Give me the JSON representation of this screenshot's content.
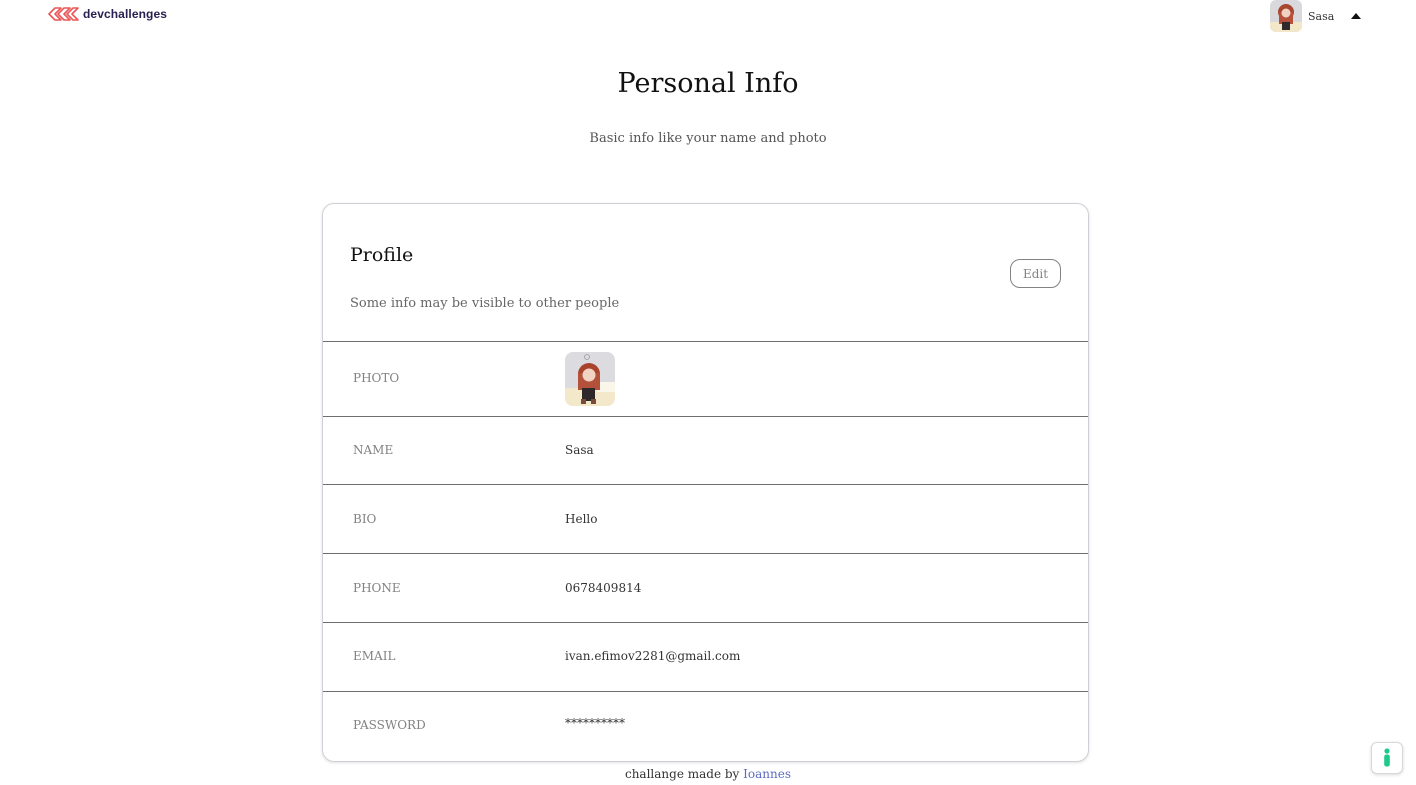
{
  "header": {
    "logo_text": "devchallenges",
    "user_name": "Sasa"
  },
  "page": {
    "title": "Personal Info",
    "subtitle": "Basic info like your name and photo"
  },
  "profile": {
    "title": "Profile",
    "subtitle": "Some info may be visible to other people",
    "edit_label": "Edit",
    "rows": {
      "photo": {
        "label": "PHOTO"
      },
      "name": {
        "label": "NAME",
        "value": "Sasa"
      },
      "bio": {
        "label": "BIO",
        "value": "Hello"
      },
      "phone": {
        "label": "PHONE",
        "value": "0678409814"
      },
      "email": {
        "label": "EMAIL",
        "value": "ivan.efimov2281@gmail.com"
      },
      "password": {
        "label": "PASSWORD",
        "value": "**********"
      }
    }
  },
  "footer": {
    "prefix": "challange made by",
    "author": "Ioannes"
  },
  "colors": {
    "logo_red": "#eb5757",
    "logo_text": "#282051",
    "link": "#5c6bc0",
    "help_green": "#1ec98b"
  },
  "icons": {
    "logo": "devchallenges-logo-icon",
    "caret": "caret-up-icon",
    "help": "accessibility-person-icon"
  }
}
